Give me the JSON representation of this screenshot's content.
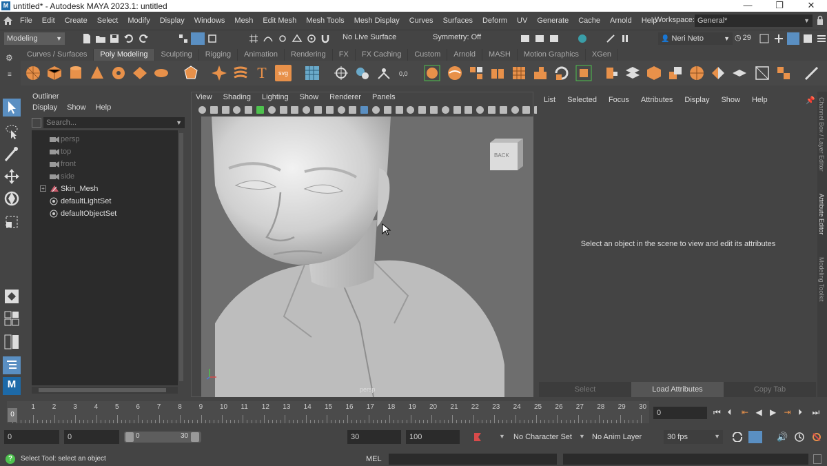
{
  "window": {
    "title": "untitled* - Autodesk MAYA 2023.1: untitled",
    "app_icon_letter": "M",
    "controls": [
      "—",
      "❐",
      "✕"
    ]
  },
  "menubar": {
    "items": [
      "File",
      "Edit",
      "Create",
      "Select",
      "Modify",
      "Display",
      "Windows",
      "Mesh",
      "Edit Mesh",
      "Mesh Tools",
      "Mesh Display",
      "Curves",
      "Surfaces",
      "Deform",
      "UV",
      "Generate",
      "Cache",
      "Arnold",
      "Help"
    ],
    "workspace_label": "Workspace:",
    "workspace_value": "General*"
  },
  "statusline": {
    "menuset": "Modeling",
    "live_surface": "No Live Surface",
    "symmetry": "Symmetry: Off",
    "user": "Neri Neto",
    "notifications": "29"
  },
  "shelf": {
    "tabs": [
      "Curves / Surfaces",
      "Poly Modeling",
      "Sculpting",
      "Rigging",
      "Animation",
      "Rendering",
      "FX",
      "FX Caching",
      "Custom",
      "Arnold",
      "MASH",
      "Motion Graphics",
      "XGen"
    ],
    "active_tab": "Poly Modeling"
  },
  "outliner": {
    "title": "Outliner",
    "menus": [
      "Display",
      "Show",
      "Help"
    ],
    "search_placeholder": "Search...",
    "items": [
      {
        "label": "persp",
        "type": "camera",
        "dim": true
      },
      {
        "label": "top",
        "type": "camera",
        "dim": true
      },
      {
        "label": "front",
        "type": "camera",
        "dim": true
      },
      {
        "label": "side",
        "type": "camera",
        "dim": true
      },
      {
        "label": "Skin_Mesh",
        "type": "mesh",
        "dim": false
      },
      {
        "label": "defaultLightSet",
        "type": "set",
        "dim": false
      },
      {
        "label": "defaultObjectSet",
        "type": "set",
        "dim": false
      }
    ]
  },
  "viewport": {
    "menus": [
      "View",
      "Shading",
      "Lighting",
      "Show",
      "Renderer",
      "Panels"
    ],
    "camera_label": "persp",
    "viewcube_face": "BACK"
  },
  "attribute_editor": {
    "menus": [
      "List",
      "Selected",
      "Focus",
      "Attributes",
      "Display",
      "Show",
      "Help"
    ],
    "message": "Select an object in the scene to view and edit its attributes",
    "buttons": [
      "Select",
      "Load Attributes",
      "Copy Tab"
    ],
    "side_tabs": [
      "Channel Box / Layer Editor",
      "Attribute Editor",
      "Modeling Toolkit"
    ]
  },
  "timeslider": {
    "ticks": [
      "0",
      "1",
      "2",
      "3",
      "4",
      "5",
      "6",
      "7",
      "8",
      "9",
      "10",
      "11",
      "12",
      "13",
      "14",
      "15",
      "16",
      "17",
      "18",
      "19",
      "20",
      "21",
      "22",
      "23",
      "24",
      "25",
      "26",
      "27",
      "28",
      "29",
      "30"
    ],
    "current_frame_marker": "0",
    "current_time": "0"
  },
  "range": {
    "start": "0",
    "playback_start": "0",
    "slider_start": "0",
    "slider_end": "30",
    "playback_end": "30",
    "end": "100",
    "character_set": "No Character Set",
    "anim_layer": "No Anim Layer",
    "fps": "30 fps"
  },
  "commandline": {
    "language": "MEL",
    "help_text": "Select Tool: select an object"
  },
  "colors": {
    "accent_orange": "#e8914a",
    "active_blue": "#5a8fc2",
    "panel_bg": "#444444"
  }
}
